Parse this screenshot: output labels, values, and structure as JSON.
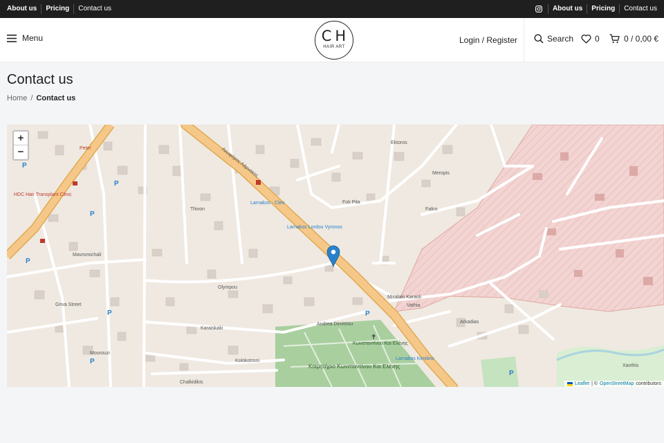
{
  "topbar": {
    "left_links": [
      "About us",
      "Pricing",
      "Contact us"
    ],
    "right_links": [
      "About us",
      "Pricing",
      "Contact us"
    ]
  },
  "header": {
    "menu_label": "Menu",
    "logo_main": "CH",
    "logo_sub": "HAIR ART",
    "login_label": "Login / Register",
    "search_label": "Search",
    "wishlist_count": "0",
    "cart_label": "0 / 0,00 €"
  },
  "page": {
    "title": "Contact us",
    "breadcrumb_home": "Home",
    "breadcrumb_sep": "/",
    "breadcrumb_current": "Contact us"
  },
  "map": {
    "zoom_in": "+",
    "zoom_out": "−",
    "attribution": {
      "leaflet": "Leaflet",
      "separator": "| ©",
      "osm": "OpenStreetMap",
      "contributors": "contributors"
    },
    "labels": {
      "street_1": "Olympou",
      "street_2": "Mixalaki Karaoli",
      "street_3": "Karaiskaki",
      "street_4": "Kolokotroni",
      "street_5": "Foti Pita",
      "street_6": "Chalkidikis",
      "street_7": "Mavromichali",
      "street_8": "Griva Street",
      "street_9": "Thivon",
      "street_10": "Ektoros",
      "street_11": "Meropis",
      "street_12": "Faliro",
      "street_13": "Andrea Dimitriou",
      "street_14": "Arkadias",
      "street_15": "Mourouzi",
      "street_16": "Xanthis",
      "avenue": "Λεωφόρος Λάρνακος",
      "cemetery": "Κοιμητήριο Κωνσταντίνου Και Ελένης",
      "church": "Κωνσταντίνου Και Ελένης",
      "clinic": "HDC Hair Transplant Clinic",
      "stop_1": "Larnakos - Cleo",
      "stop_2": "Larnakos Lordou Vyronos",
      "stop_3": "Larnakos Kimitirio",
      "shop_1": "Peter",
      "bank": "Vathia"
    },
    "colors": {
      "land": "#efe9e1",
      "road": "#ffffff",
      "avenue": "#f5c88a",
      "military": "#f2d4d2",
      "park": "#c6e3bf",
      "cemetery": "#a9cf9f",
      "building": "#d9d0c9",
      "marker": "#2a81cb"
    }
  }
}
